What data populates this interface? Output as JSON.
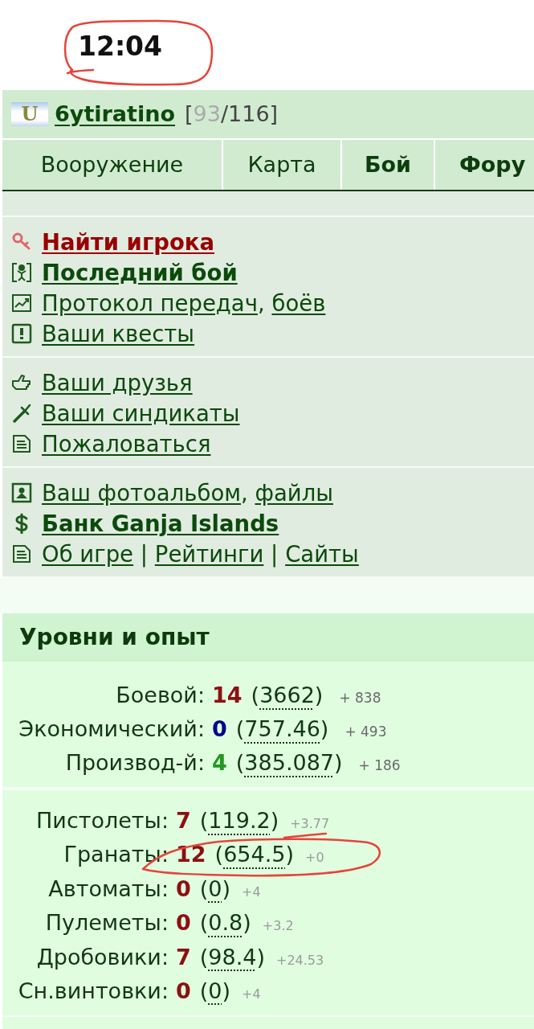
{
  "status_bar": {
    "time": "12:04"
  },
  "header": {
    "clan_badge": "U",
    "username": "6ytiratino",
    "health": {
      "open": "[",
      "current": "93",
      "rest": "/116]"
    }
  },
  "tabs": [
    {
      "label": "Вооружение",
      "bold": false
    },
    {
      "label": "Карта",
      "bold": false
    },
    {
      "label": "Бой",
      "bold": true
    },
    {
      "label": "Фору",
      "bold": true
    }
  ],
  "menu": {
    "sections": [
      {
        "items": [
          {
            "kind": "search",
            "color": "#990000",
            "bold": true,
            "parts": [
              {
                "kind": "link",
                "text": "Найти игрока"
              }
            ]
          },
          {
            "kind": "battle",
            "color": "#0b4a0b",
            "bold": true,
            "parts": [
              {
                "kind": "link",
                "text": "Последний бой"
              }
            ]
          },
          {
            "kind": "log",
            "color": "#0b4a0b",
            "bold": false,
            "parts": [
              {
                "kind": "link",
                "text": "Протокол передач"
              },
              {
                "kind": "text",
                "text": ", "
              },
              {
                "kind": "link",
                "text": "боёв"
              }
            ]
          },
          {
            "kind": "quest",
            "color": "#0b4a0b",
            "bold": false,
            "parts": [
              {
                "kind": "link",
                "text": "Ваши квесты"
              }
            ]
          }
        ]
      },
      {
        "items": [
          {
            "kind": "friends",
            "color": "#0b4a0b",
            "bold": false,
            "parts": [
              {
                "kind": "link",
                "text": "Ваши друзья"
              }
            ]
          },
          {
            "kind": "syndicates",
            "color": "#0b4a0b",
            "bold": false,
            "parts": [
              {
                "kind": "link",
                "text": "Ваши синдикаты"
              }
            ]
          },
          {
            "kind": "complaint",
            "color": "#0b4a0b",
            "bold": false,
            "parts": [
              {
                "kind": "link",
                "text": "Пожаловаться"
              }
            ]
          }
        ]
      },
      {
        "items": [
          {
            "kind": "photos",
            "color": "#0b4a0b",
            "bold": false,
            "parts": [
              {
                "kind": "link",
                "text": "Ваш фотоальбом"
              },
              {
                "kind": "text",
                "text": ", "
              },
              {
                "kind": "link",
                "text": "файлы"
              }
            ]
          },
          {
            "kind": "bank",
            "color": "#0b4a0b",
            "bold": true,
            "parts": [
              {
                "kind": "link",
                "text": "Банк Ganja Islands"
              }
            ]
          },
          {
            "kind": "about",
            "color": "#0b4a0b",
            "bold": false,
            "parts": [
              {
                "kind": "link",
                "text": "Об игре"
              },
              {
                "kind": "text",
                "text": " | "
              },
              {
                "kind": "link",
                "text": "Рейтинги"
              },
              {
                "kind": "text",
                "text": " | "
              },
              {
                "kind": "link",
                "text": "Сайты"
              }
            ]
          }
        ]
      }
    ]
  },
  "levels": {
    "title": "Уровни и опыт",
    "skills": [
      {
        "label": "Боевой:",
        "rank": "14",
        "color": "#8b1111",
        "exp_open": "(",
        "exp": "3662",
        "exp_close": ")",
        "gain": "+ 838"
      },
      {
        "label": "Экономический:",
        "rank": "0",
        "color": "#00008b",
        "exp_open": "(",
        "exp": "757.46",
        "exp_close": ")",
        "gain": "+ 493"
      },
      {
        "label": "Производ-й:",
        "rank": "4",
        "color": "#229922",
        "exp_open": "(",
        "exp": "385.087",
        "exp_close": ")",
        "gain": "+ 186"
      }
    ],
    "weapons": [
      {
        "label": "Пистолеты:",
        "rank": "7",
        "exp_open": "(",
        "exp": "119.2",
        "exp_close": ")",
        "gain": "+3.77"
      },
      {
        "label": "Гранаты:",
        "rank": "12",
        "exp_open": "(",
        "exp": "654.5",
        "exp_close": ")",
        "gain": "+0"
      },
      {
        "label": "Автоматы:",
        "rank": "0",
        "exp_open": "(",
        "exp": "0",
        "exp_close": ")",
        "gain": "+4"
      },
      {
        "label": "Пулеметы:",
        "rank": "0",
        "exp_open": "(",
        "exp": "0.8",
        "exp_close": ")",
        "gain": "+3.2"
      },
      {
        "label": "Дробовики:",
        "rank": "7",
        "exp_open": "(",
        "exp": "98.4",
        "exp_close": ")",
        "gain": "+24.53"
      },
      {
        "label": "Сн.винтовки:",
        "rank": "0",
        "exp_open": "(",
        "exp": "0",
        "exp_close": ")",
        "gain": "+4"
      }
    ]
  }
}
